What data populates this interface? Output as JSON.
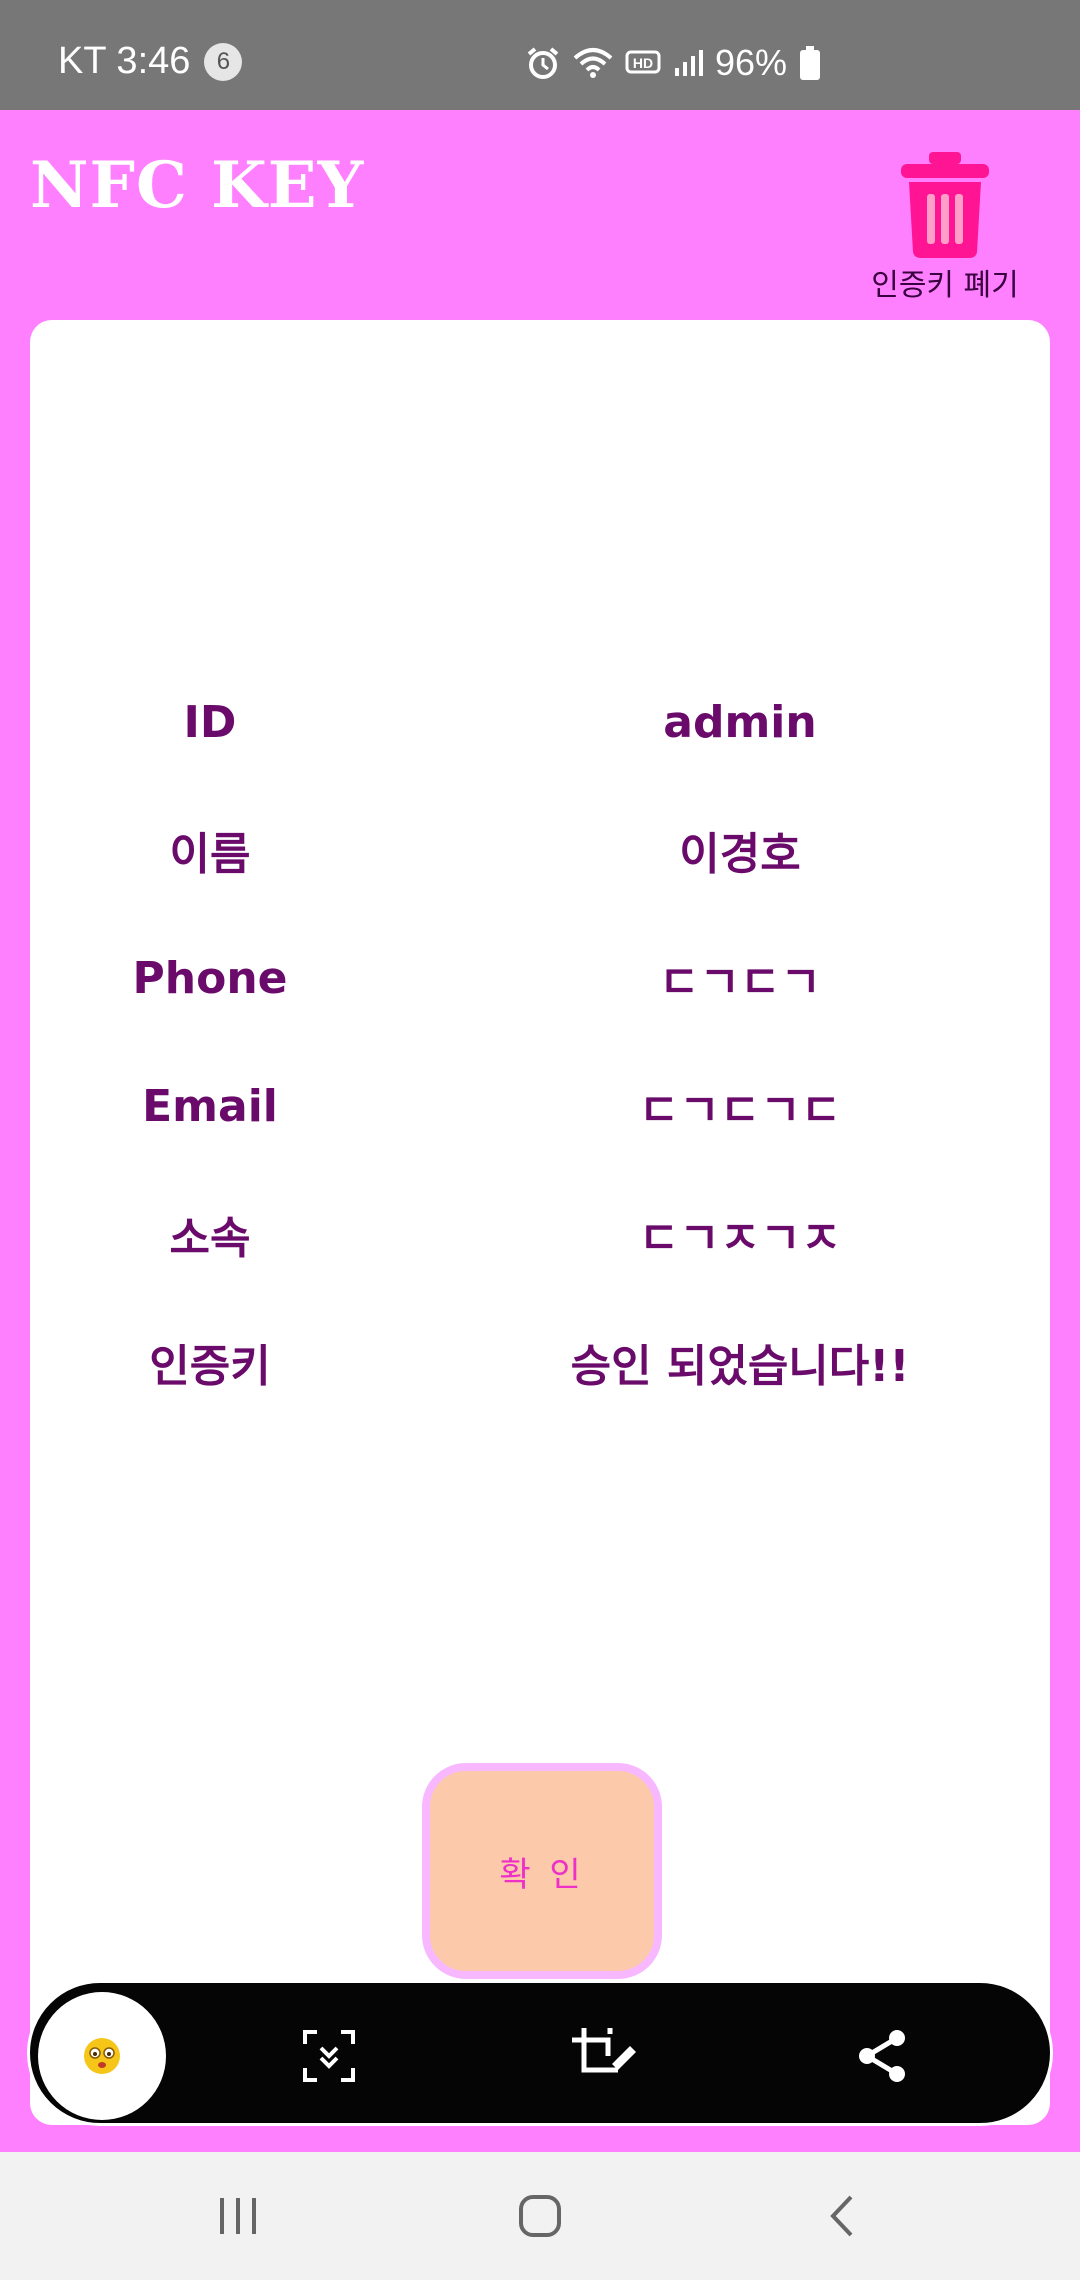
{
  "status_bar": {
    "carrier_time": "KT 3:46",
    "notification_count": "6",
    "battery": "96%",
    "icons": [
      "alarm-icon",
      "wifi-icon",
      "hd-icon",
      "signal-icon",
      "battery-icon"
    ]
  },
  "header": {
    "title": "NFC KEY",
    "delete_label": "인증키 폐기",
    "delete_icon": "trash-icon"
  },
  "info": {
    "rows": [
      {
        "label": "ID",
        "value": "admin"
      },
      {
        "label": "이름",
        "value": "이경호"
      },
      {
        "label": "Phone",
        "value": "ㄷㄱㄷㄱ"
      },
      {
        "label": "Email",
        "value": "ㄷㄱㄷㄱㄷ"
      },
      {
        "label": "소속",
        "value": "ㄷㄱㅈㄱㅈ"
      },
      {
        "label": "인증키",
        "value": "승인 되었습니다!!"
      }
    ]
  },
  "confirm_label": "확 인",
  "toolbar": {
    "items": [
      "avatar-emoji",
      "scroll-capture-icon",
      "crop-edit-icon",
      "share-icon"
    ]
  },
  "nav": {
    "items": [
      "recent-apps-icon",
      "home-icon",
      "back-icon"
    ]
  },
  "colors": {
    "background": "#ff80ff",
    "card": "#ffffff",
    "text_purple": "#6a0a6a",
    "trash": "#ff1493",
    "confirm_bg": "#fccaaa",
    "confirm_border": "#f7b8ff",
    "confirm_text": "#ee2fc8"
  }
}
